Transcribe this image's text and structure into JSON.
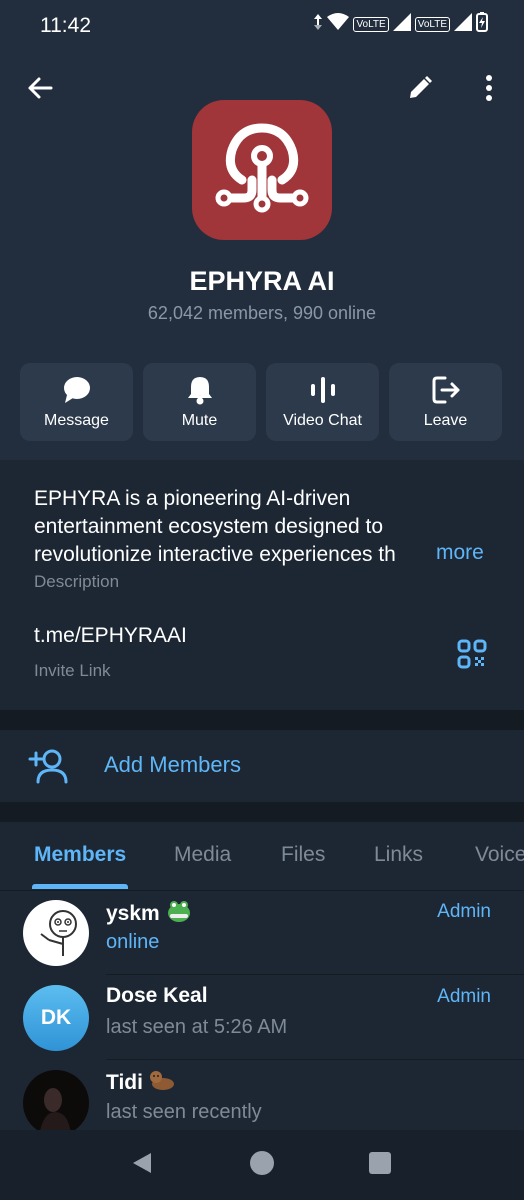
{
  "status": {
    "time": "11:42",
    "volte1": "VoLTE",
    "volte2": "VoLTE"
  },
  "topbar": {
    "back_icon": "arrow-left-icon",
    "edit_icon": "pencil-icon",
    "more_icon": "more-vertical-icon"
  },
  "profile": {
    "name": "EPHYRA AI",
    "subtitle": "62,042 members, 990 online",
    "avatar_color": "#a0353a"
  },
  "actions": [
    {
      "label": "Message",
      "icon": "chat-bubble-icon"
    },
    {
      "label": "Mute",
      "icon": "bell-icon"
    },
    {
      "label": "Video Chat",
      "icon": "voice-chat-icon"
    },
    {
      "label": "Leave",
      "icon": "leave-icon"
    }
  ],
  "info": {
    "description_line1": "EPHYRA is a pioneering AI-driven",
    "description_line2": "entertainment ecosystem designed to",
    "description_line3": "revolutionize interactive experiences th",
    "more_label": "more",
    "description_caption": "Description",
    "invite_link": "t.me/EPHYRAAI",
    "invite_caption": "Invite Link"
  },
  "add_members": {
    "label": "Add Members"
  },
  "tabs": [
    {
      "label": "Members",
      "active": true
    },
    {
      "label": "Media"
    },
    {
      "label": "Files"
    },
    {
      "label": "Links"
    },
    {
      "label": "Voice"
    }
  ],
  "members": [
    {
      "name": "yskm",
      "status": "online",
      "role": "Admin",
      "avatar": "meme-face"
    },
    {
      "name": "Dose Keal",
      "status": "last seen at 5:26 AM",
      "role": "Admin",
      "initials": "DK",
      "avatar_color": "#3ba3df"
    },
    {
      "name": "Tidi",
      "status": "last seen recently",
      "role": "",
      "avatar": "dark-photo"
    }
  ],
  "colors": {
    "accent": "#5eb5f7",
    "background": "#1d2733",
    "header": "#222e3d",
    "button": "#2c3a4b"
  }
}
